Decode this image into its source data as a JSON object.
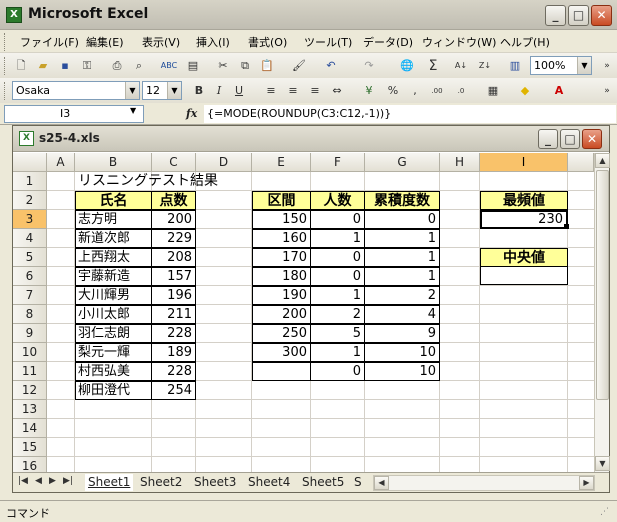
{
  "app": {
    "title": "Microsoft Excel"
  },
  "menu": [
    "ファイル(F)",
    "編集(E)",
    "表示(V)",
    "挿入(I)",
    "書式(O)",
    "ツール(T)",
    "データ(D)",
    "ウィンドウ(W)",
    "ヘルプ(H)"
  ],
  "toolbar": {
    "zoom": "100%"
  },
  "format_toolbar": {
    "font": "Osaka",
    "size": "12"
  },
  "formula_bar": {
    "name_box": "I3",
    "fx": "fx",
    "formula": "{=MODE(ROUNDUP(C3:C12,-1))}"
  },
  "workbook": {
    "title": "s25-4.xls"
  },
  "columns": [
    "A",
    "B",
    "C",
    "D",
    "E",
    "F",
    "G",
    "H",
    "I"
  ],
  "rows": [
    "1",
    "2",
    "3",
    "4",
    "5",
    "6",
    "7",
    "8",
    "9",
    "10",
    "11",
    "12",
    "13",
    "14",
    "15",
    "16"
  ],
  "sheet": {
    "title": "リスニングテスト結果",
    "header_name": "氏名",
    "header_score": "点数",
    "header_range": "区間",
    "header_count": "人数",
    "header_cumulative": "累積度数",
    "header_mode": "最頻値",
    "header_median": "中央値",
    "mode_value": "230",
    "students": [
      {
        "name": "志方明",
        "score": "200"
      },
      {
        "name": "新道次郎",
        "score": "229"
      },
      {
        "name": "上西翔太",
        "score": "208"
      },
      {
        "name": "宇藤新造",
        "score": "157"
      },
      {
        "name": "大川輝男",
        "score": "196"
      },
      {
        "name": "小川太郎",
        "score": "211"
      },
      {
        "name": "羽仁志朗",
        "score": "228"
      },
      {
        "name": "梨元一輝",
        "score": "189"
      },
      {
        "name": "村西弘美",
        "score": "228"
      },
      {
        "name": "柳田澄代",
        "score": "254"
      }
    ],
    "freq": [
      {
        "range": "150",
        "count": "0",
        "cum": "0"
      },
      {
        "range": "160",
        "count": "1",
        "cum": "1"
      },
      {
        "range": "170",
        "count": "0",
        "cum": "1"
      },
      {
        "range": "180",
        "count": "0",
        "cum": "1"
      },
      {
        "range": "190",
        "count": "1",
        "cum": "2"
      },
      {
        "range": "200",
        "count": "2",
        "cum": "4"
      },
      {
        "range": "250",
        "count": "5",
        "cum": "9"
      },
      {
        "range": "300",
        "count": "1",
        "cum": "10"
      },
      {
        "range": "",
        "count": "0",
        "cum": "10"
      }
    ]
  },
  "tabs": [
    "Sheet1",
    "Sheet2",
    "Sheet3",
    "Sheet4",
    "Sheet5",
    "S"
  ],
  "status": {
    "text": "コマンド"
  },
  "colors": {
    "header_fill": "#ffff99",
    "selected_header": "#f9c26a"
  }
}
